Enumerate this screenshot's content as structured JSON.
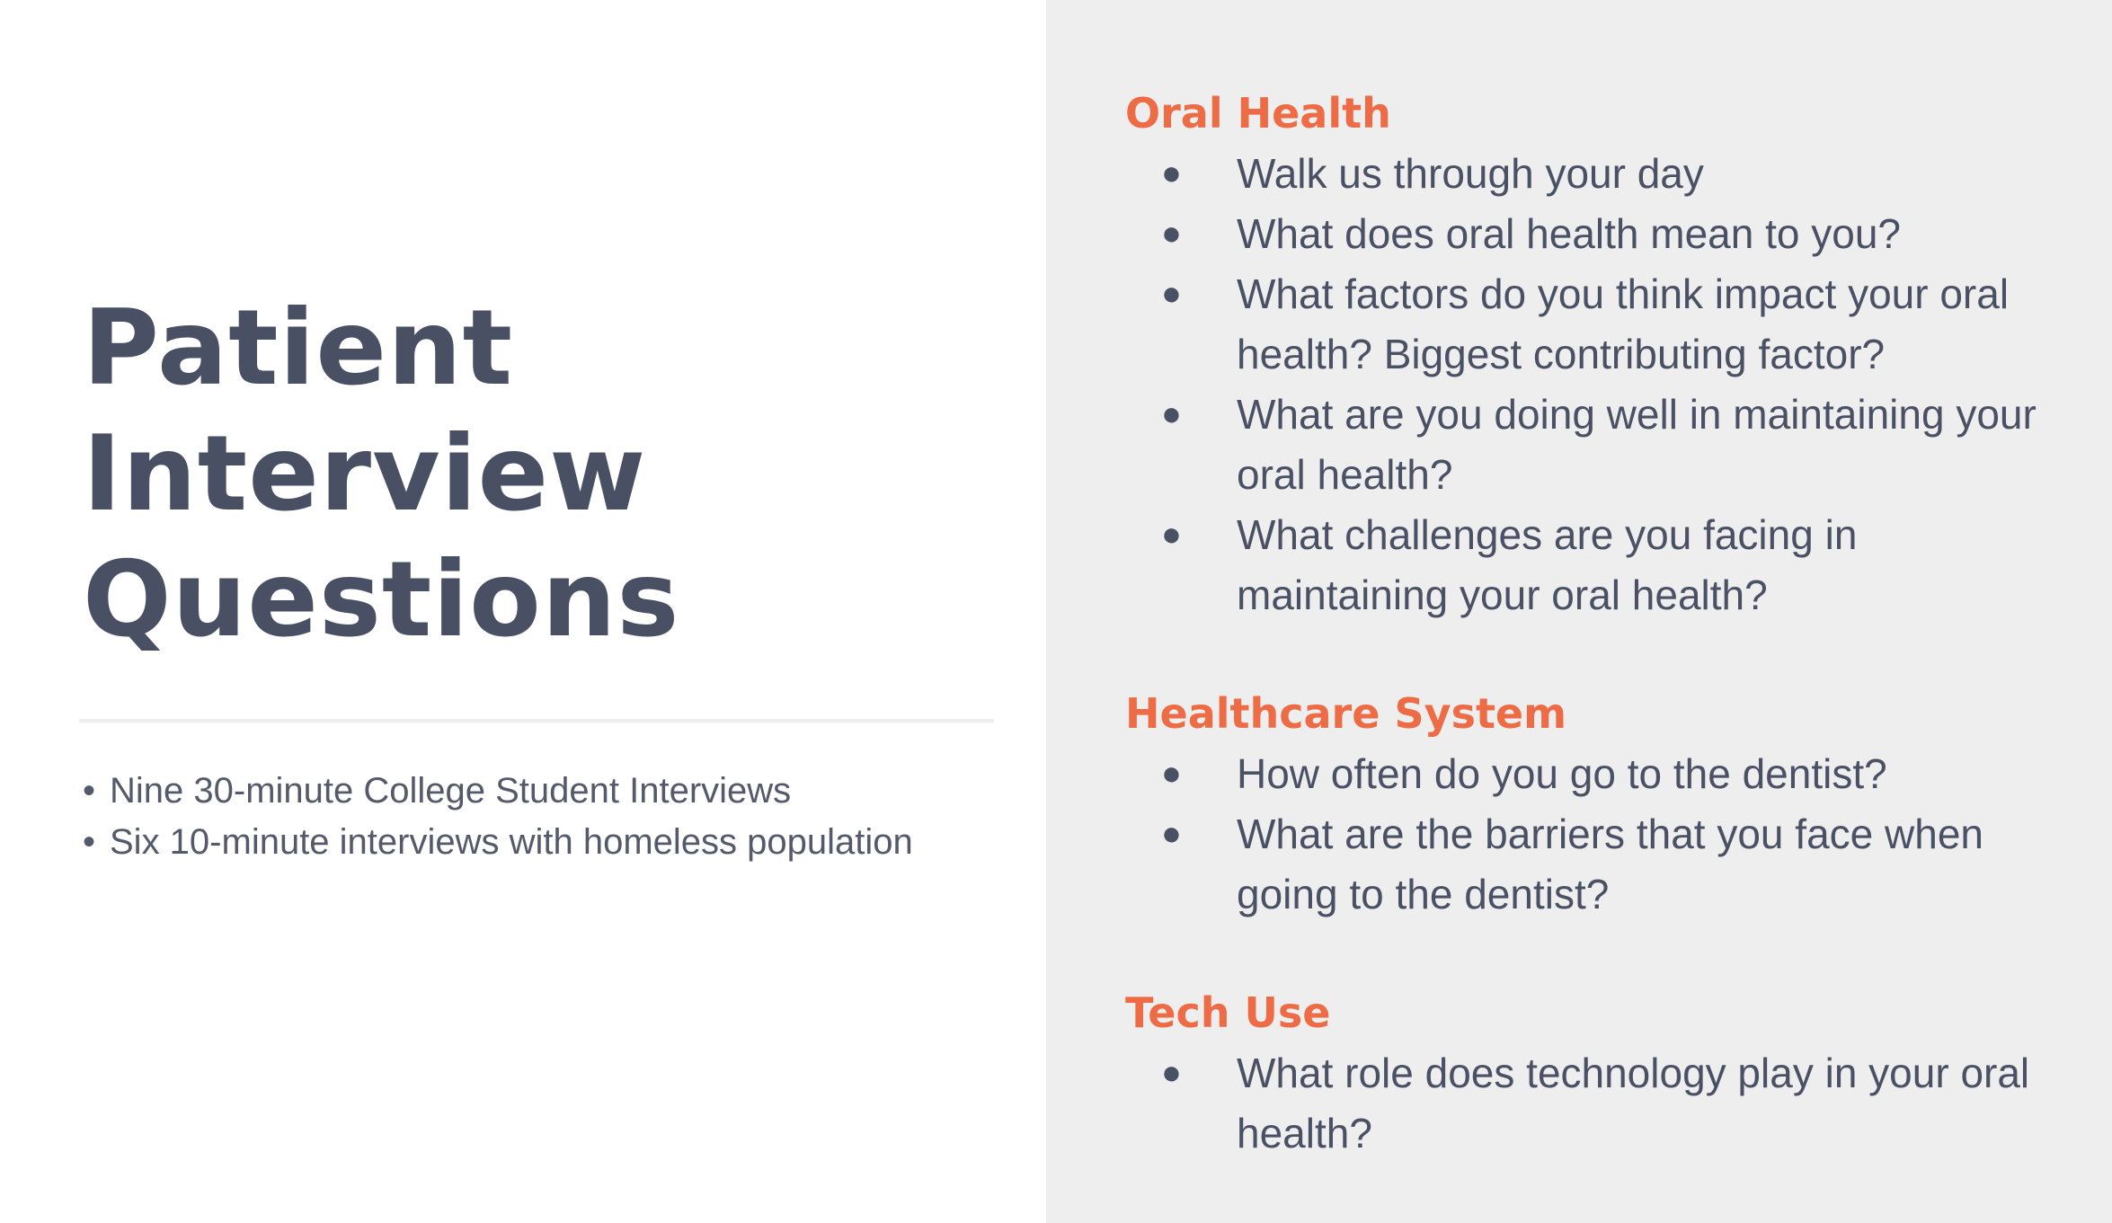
{
  "title": {
    "line1": "Patient",
    "line2": "Interview",
    "line3": "Questions"
  },
  "summary": [
    "Nine 30-minute College Student Interviews",
    "Six 10-minute interviews with homeless population"
  ],
  "sections": [
    {
      "heading": "Oral Health",
      "questions": [
        "Walk us through your day",
        "What does oral health mean to you?",
        "What factors do you think impact your oral health? Biggest contributing factor?",
        "What are you doing well in maintaining your oral health?",
        "What challenges are you facing in maintaining your oral health?"
      ]
    },
    {
      "heading": "Healthcare System",
      "questions": [
        "How often do you go to the dentist?",
        "What are the barriers that you face when going to the dentist?"
      ]
    },
    {
      "heading": "Tech Use",
      "questions": [
        "What role does technology play in your oral health?"
      ]
    }
  ],
  "colors": {
    "heading_accent": "#ed6c45",
    "title_text": "#4a5064",
    "right_panel_bg": "#eeeeee"
  }
}
